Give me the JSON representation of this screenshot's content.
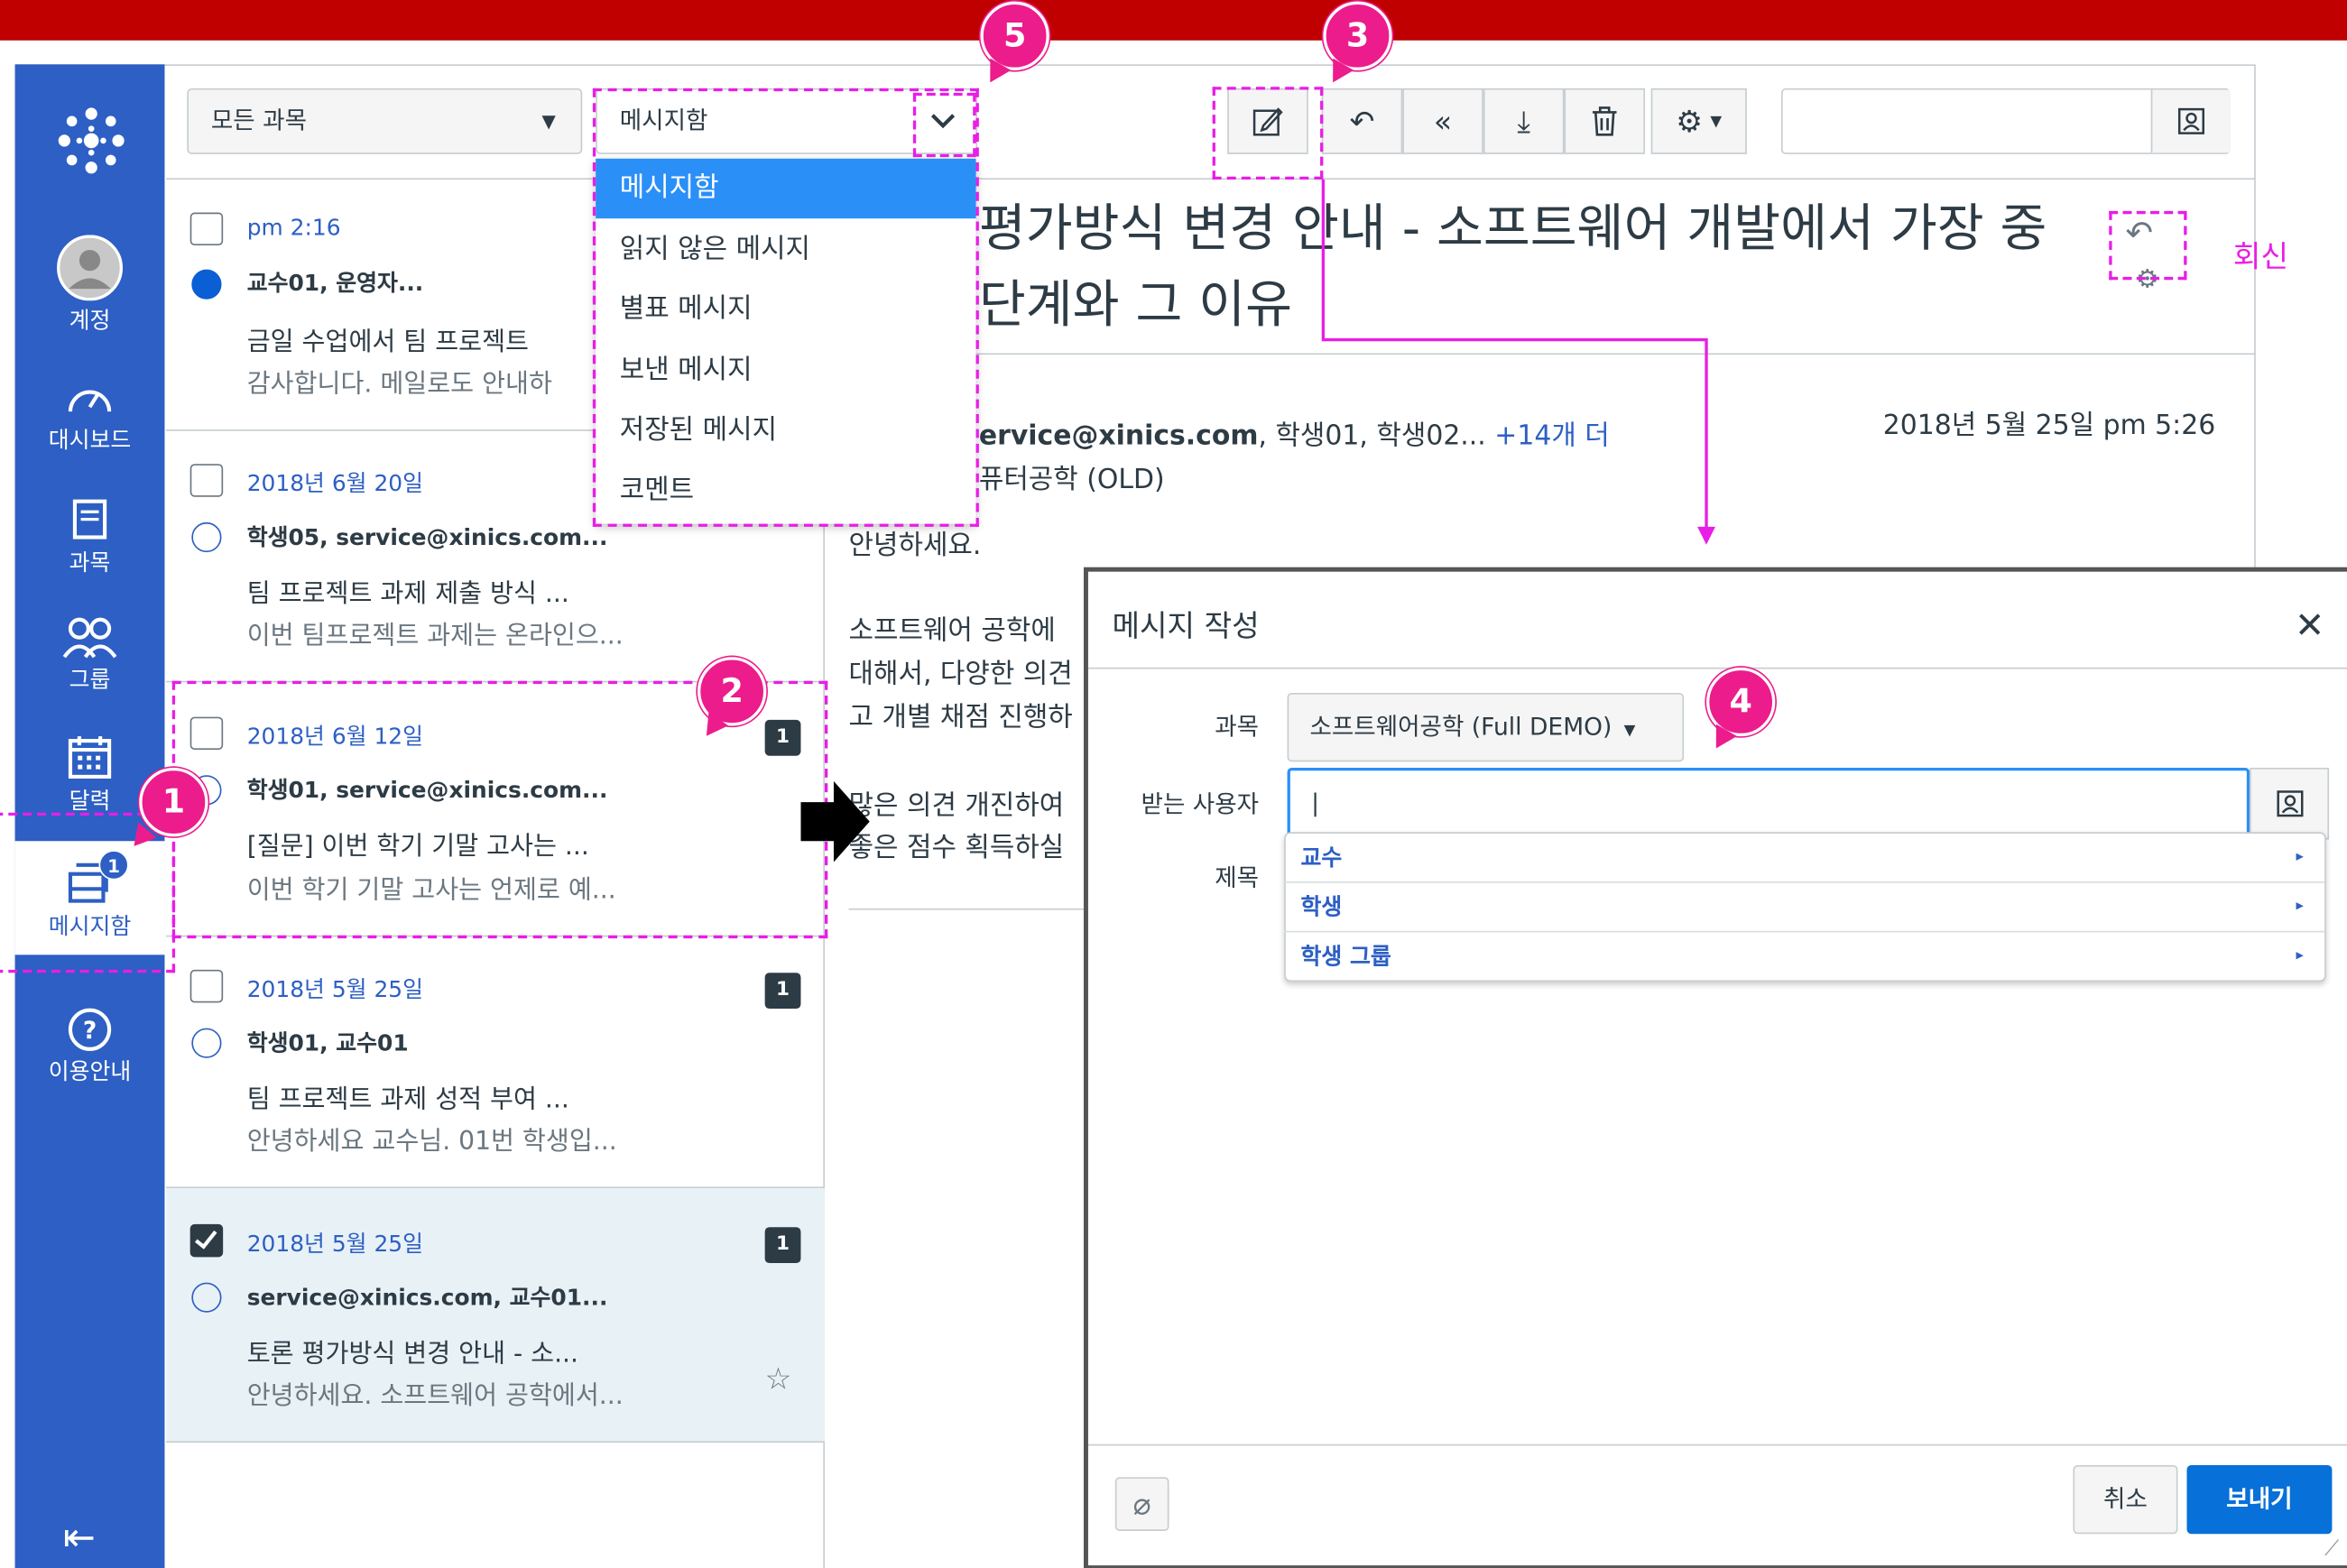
{
  "global_nav": {
    "items": [
      {
        "label": "계정"
      },
      {
        "label": "대시보드"
      },
      {
        "label": "과목"
      },
      {
        "label": "그룹"
      },
      {
        "label": "달력"
      },
      {
        "label": "메시지함",
        "badge": "1"
      },
      {
        "label": "이용안내"
      }
    ]
  },
  "toolbar": {
    "course_filter": "모든 과목",
    "mailbox_filter": "메시지함",
    "search_value": ""
  },
  "mailbox_dropdown": {
    "options": [
      "메시지함",
      "읽지 않은 메시지",
      "별표 메시지",
      "보낸 메시지",
      "저장된 메시지",
      "코멘트"
    ],
    "selected": "메시지함"
  },
  "conversations": [
    {
      "date": "pm 2:16",
      "participants": "교수01, 운영자...",
      "subject": "금일 수업에서 팀 프로젝트",
      "preview": "감사합니다. 메일로도 안내하",
      "unread": true,
      "checked": false
    },
    {
      "date": "2018년 6월 20일",
      "participants": "학생05, service@xinics.com...",
      "subject": "팀 프로젝트 과제 제출 방식 ...",
      "preview": "이번 팀프로젝트 과제는 온라인으...",
      "unread": false,
      "checked": false
    },
    {
      "date": "2018년 6월 12일",
      "participants": "학생01, service@xinics.com...",
      "subject": "[질문] 이번 학기 기말 고사는 ...",
      "preview": "이번 학기 기말 고사는 언제로 예...",
      "count": "1",
      "unread": false,
      "checked": false
    },
    {
      "date": "2018년 5월 25일",
      "participants": "학생01, 교수01",
      "subject": "팀 프로젝트 과제 성적 부여 ...",
      "preview": "안녕하세요 교수님. 01번 학생입...",
      "count": "1",
      "unread": false,
      "checked": false
    },
    {
      "date": "2018년 5월 25일",
      "participants": "service@xinics.com, 교수01...",
      "subject": "토론 평가방식 변경 안내 - 소...",
      "preview": "안녕하세요. 소프트웨어 공학에서...",
      "count": "1",
      "unread": false,
      "checked": true
    }
  ],
  "message": {
    "title_line1": "평가방식 변경 안내 - 소프트웨어 개발에서 가장 중",
    "title_line2": "단계와 그 이유",
    "sender_partial": "ervice@xinics.com",
    "recipients": ", 학생01, 학생02...",
    "more_link": "+14개 더",
    "course_partial": "퓨터공학 (OLD)",
    "date": "2018년 5월 25일 pm 5:26",
    "body": [
      "안녕하세요.",
      "소프트웨어 공학에",
      "대해서, 다양한 의견",
      "고 개별 채점 진행하",
      "많은 의견 개진하여",
      "좋은 점수 획득하실"
    ]
  },
  "reply_annotation": "회신",
  "compose": {
    "title": "메시지 작성",
    "course_label": "과목",
    "course_value": "소프트웨어공학 (Full DEMO)",
    "to_label": "받는 사용자",
    "to_value": "|",
    "subject_label": "제목",
    "recipient_menu": [
      "교수",
      "학생",
      "학생 그룹"
    ],
    "cancel": "취소",
    "send": "보내기"
  },
  "callouts": [
    "1",
    "2",
    "3",
    "4",
    "5"
  ]
}
